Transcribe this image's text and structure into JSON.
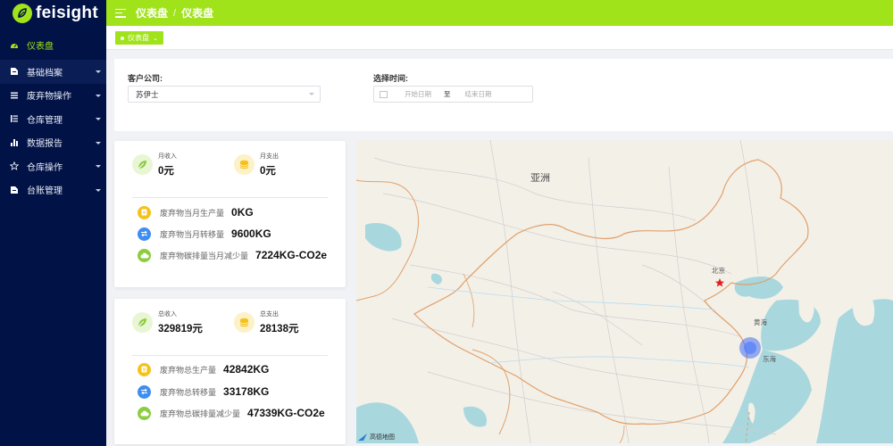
{
  "app": {
    "brand": "feisight"
  },
  "header": {
    "crumb_1": "仪表盘",
    "crumb_sep": "/",
    "crumb_2": "仪表盘"
  },
  "tabs": [
    {
      "label": "仪表盘",
      "close": "⌄"
    }
  ],
  "sidebar": {
    "items": [
      {
        "label": "仪表盘",
        "icon": "dashboard-icon"
      },
      {
        "label": "基础档案",
        "icon": "document-icon"
      },
      {
        "label": "废弃物操作",
        "icon": "list-icon"
      },
      {
        "label": "仓库管理",
        "icon": "warehouse-list-icon"
      },
      {
        "label": "数据报告",
        "icon": "bar-chart-icon"
      },
      {
        "label": "仓库操作",
        "icon": "star-icon"
      },
      {
        "label": "台账管理",
        "icon": "ledger-icon"
      }
    ]
  },
  "filter": {
    "company_label": "客户公司:",
    "company_value": "苏伊士",
    "time_label": "选择时间:",
    "start_placeholder": "开始日期",
    "to": "至",
    "end_placeholder": "结束日期"
  },
  "monthly": {
    "income_label": "月收入",
    "income_value": "0元",
    "expense_label": "月支出",
    "expense_value": "0元",
    "rows": [
      {
        "label": "废弃物当月生产量",
        "value": "0KG",
        "icon": "document-icon"
      },
      {
        "label": "废弃物当月转移量",
        "value": "9600KG",
        "icon": "transfer-icon"
      },
      {
        "label": "废弃物碳排量当月减少量",
        "value": "7224KG-CO2e",
        "icon": "cloud-icon"
      }
    ]
  },
  "total": {
    "income_label": "总收入",
    "income_value": "329819元",
    "expense_label": "总支出",
    "expense_value": "28138元",
    "rows": [
      {
        "label": "废弃物总生产量",
        "value": "42842KG",
        "icon": "document-icon"
      },
      {
        "label": "废弃物总转移量",
        "value": "33178KG",
        "icon": "transfer-icon"
      },
      {
        "label": "废弃物总碳排量减少量",
        "value": "47339KG-CO2e",
        "icon": "cloud-icon"
      }
    ]
  },
  "map": {
    "continent": "亚洲",
    "beijing": "北京",
    "yellow_sea": "黄海",
    "east_sea": "东海",
    "attribution": "高德地图"
  },
  "colors": {
    "accent": "#a0e31b",
    "sidebar": "#011247"
  }
}
